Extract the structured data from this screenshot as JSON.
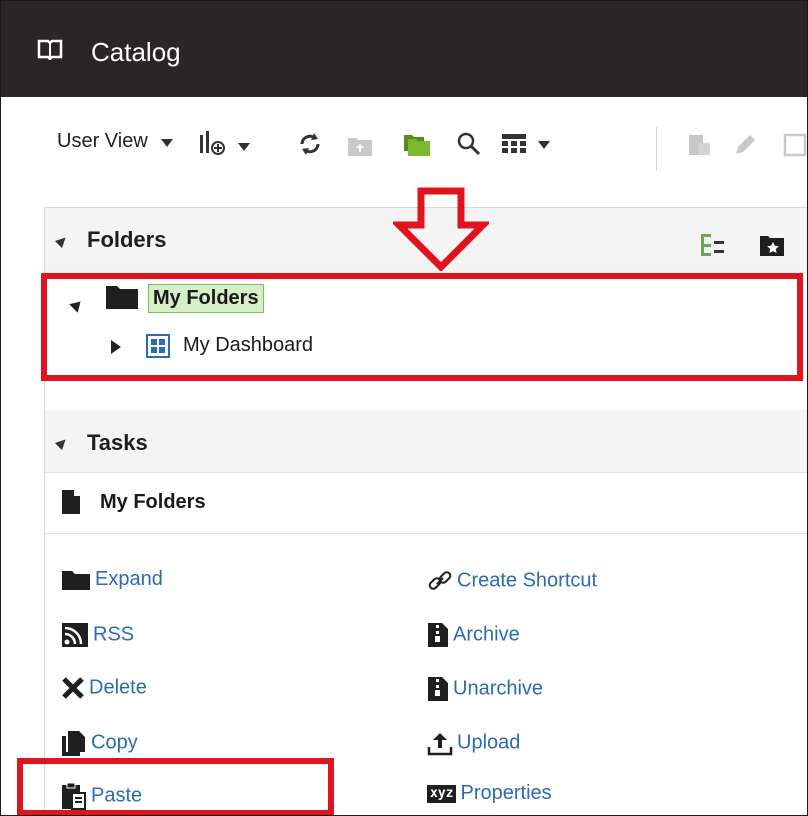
{
  "header": {
    "title": "Catalog",
    "icon": "book-icon"
  },
  "toolbar": {
    "view_label": "User View"
  },
  "folders": {
    "heading": "Folders",
    "tree": [
      {
        "label": "My Folders",
        "expanded": true,
        "selected": true
      },
      {
        "label": "My Dashboard",
        "expanded": false
      }
    ]
  },
  "tasks": {
    "heading": "Tasks",
    "context": "My Folders",
    "left": [
      "Expand",
      "RSS",
      "Delete",
      "Copy",
      "Paste"
    ],
    "right": [
      "Create Shortcut",
      "Archive",
      "Unarchive",
      "Upload",
      "Properties"
    ],
    "properties_icon_text": "xyz"
  },
  "colors": {
    "link": "#2b6cb0",
    "header_bg": "#2a2623",
    "highlight": "#e0141e",
    "selection_bg": "#d6efc9"
  }
}
